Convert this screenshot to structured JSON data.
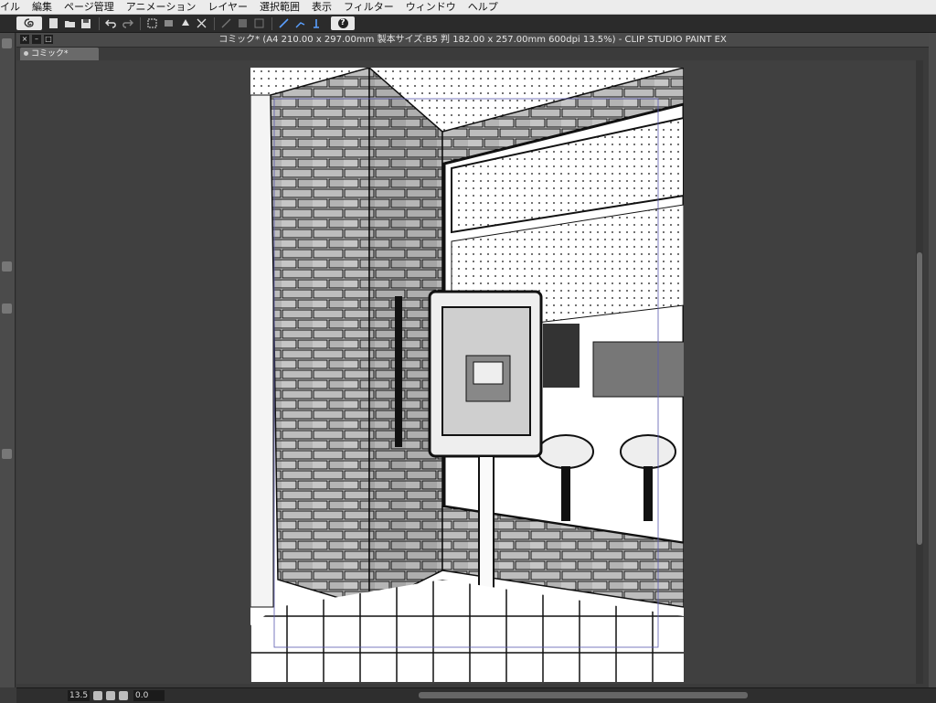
{
  "menubar": {
    "items": [
      "イル",
      "編集",
      "ページ管理",
      "アニメーション",
      "レイヤー",
      "選択範囲",
      "表示",
      "フィルター",
      "ウィンドウ",
      "ヘルプ"
    ]
  },
  "toolbar": {
    "logo_icon": "clip-studio-logo-icon",
    "buttons": [
      "new-icon",
      "open-icon",
      "save-icon",
      "undo-icon",
      "redo-icon",
      "transform-icon",
      "eraser-icon",
      "fill-icon",
      "snap-icon"
    ],
    "help_label": "?"
  },
  "window": {
    "title": "コミック* (A4 210.00 x 297.00mm 製本サイズ:B5 判 182.00 x 257.00mm 600dpi 13.5%)  - CLIP STUDIO PAINT EX",
    "tab_label": "コミック*"
  },
  "status": {
    "zoom": "13.5",
    "angle": "0.0"
  },
  "colors": {
    "menubar_bg": "#ececec",
    "toolbar_bg": "#2b2b2b",
    "workspace_bg": "#404040",
    "page_bg": "#ffffff"
  }
}
